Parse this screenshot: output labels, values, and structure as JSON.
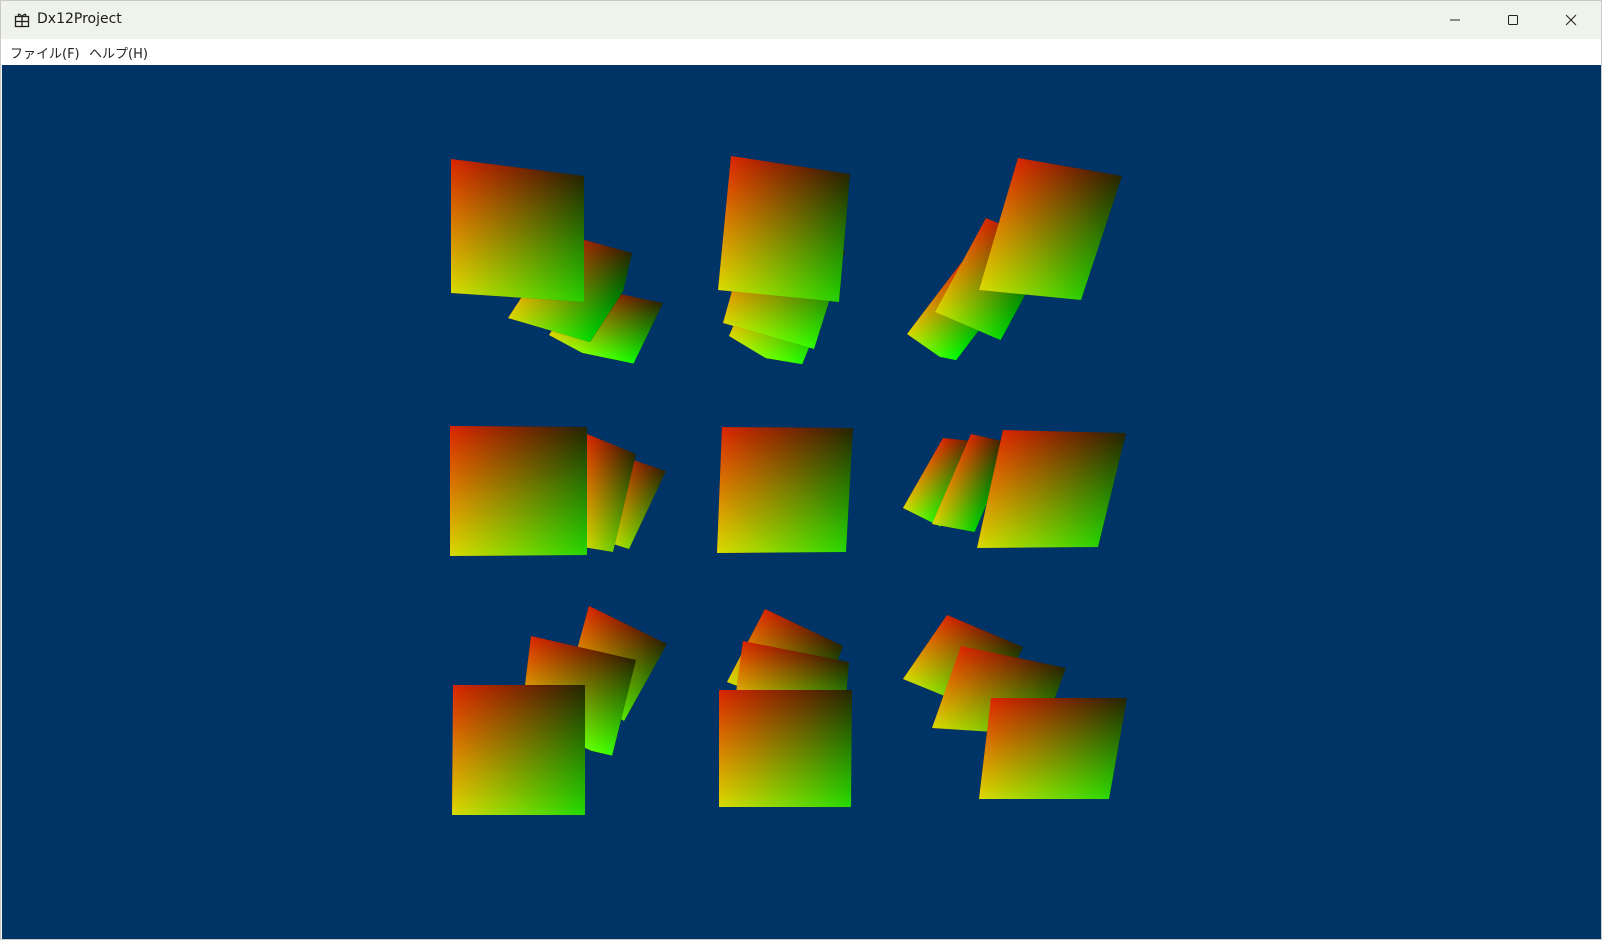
{
  "window": {
    "title": "Dx12Project",
    "caption_buttons": [
      {
        "name": "minimize-icon"
      },
      {
        "name": "maximize-icon"
      },
      {
        "name": "close-icon"
      }
    ]
  },
  "menu": {
    "file_label": "ファイル(F)",
    "help_label": "ヘルプ(H)"
  },
  "scene": {
    "clear_color": "#003366",
    "gradient_colors": {
      "top_left": "#ff0000",
      "top_right": "#000000",
      "bottom_left": "#ffff00",
      "bottom_right": "#00ff00"
    },
    "grid": "3x3",
    "objects": "rotating gradient-textured quads"
  }
}
